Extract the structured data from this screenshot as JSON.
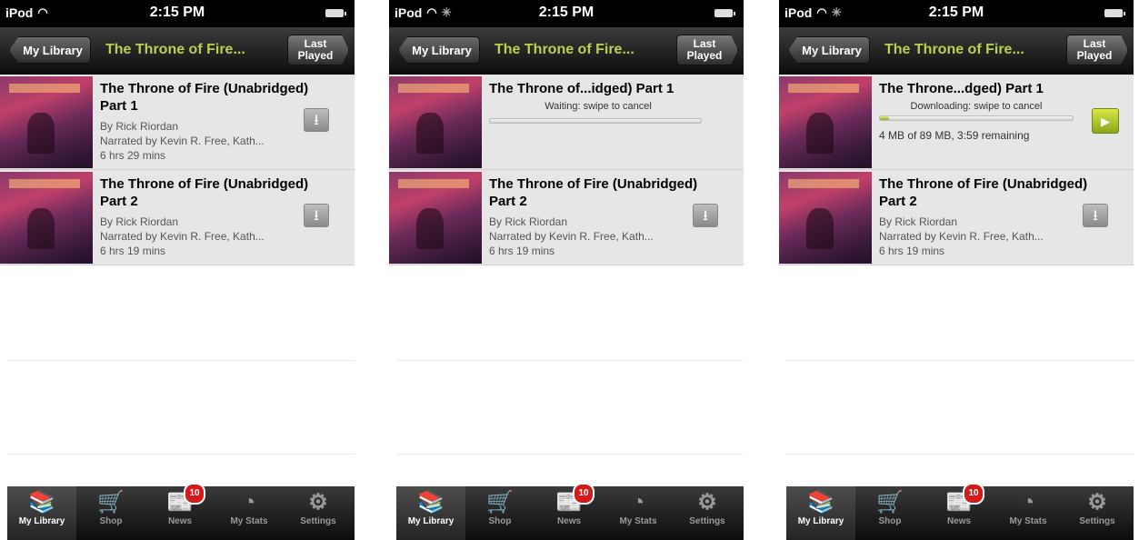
{
  "status_bar": {
    "carrier": "iPod",
    "time": "2:15 PM"
  },
  "nav": {
    "back_label": "My Library",
    "title": "The Throne of Fire...",
    "last_played_label": "Last Played"
  },
  "books": {
    "p1": {
      "title": "The Throne of Fire (Unabridged) Part 1",
      "author": "By Rick Riordan",
      "narrator": "Narrated by Kevin R. Free, Kath...",
      "duration": "6 hrs 29 mins"
    },
    "p2": {
      "title": "The Throne of Fire (Unabridged) Part 2",
      "author": "By Rick Riordan",
      "narrator": "Narrated by Kevin R. Free, Kath...",
      "duration": "6 hrs 19 mins"
    }
  },
  "screen2": {
    "row1_title": "The Throne of...idged) Part 1",
    "status": "Waiting: swipe to cancel",
    "progress": 0.0
  },
  "screen3": {
    "row1_title": "The Throne...dged) Part 1",
    "status": "Downloading: swipe to cancel",
    "remaining": "4 MB of 89 MB, 3:59 remaining",
    "progress": 0.045
  },
  "tab_bar": {
    "tabs": [
      {
        "label": "My Library",
        "icon": "books-icon"
      },
      {
        "label": "Shop",
        "icon": "cart-icon"
      },
      {
        "label": "News",
        "icon": "news-icon"
      },
      {
        "label": "My Stats",
        "icon": "stats-icon"
      },
      {
        "label": "Settings",
        "icon": "gears-icon"
      }
    ],
    "news_badge": "10"
  }
}
